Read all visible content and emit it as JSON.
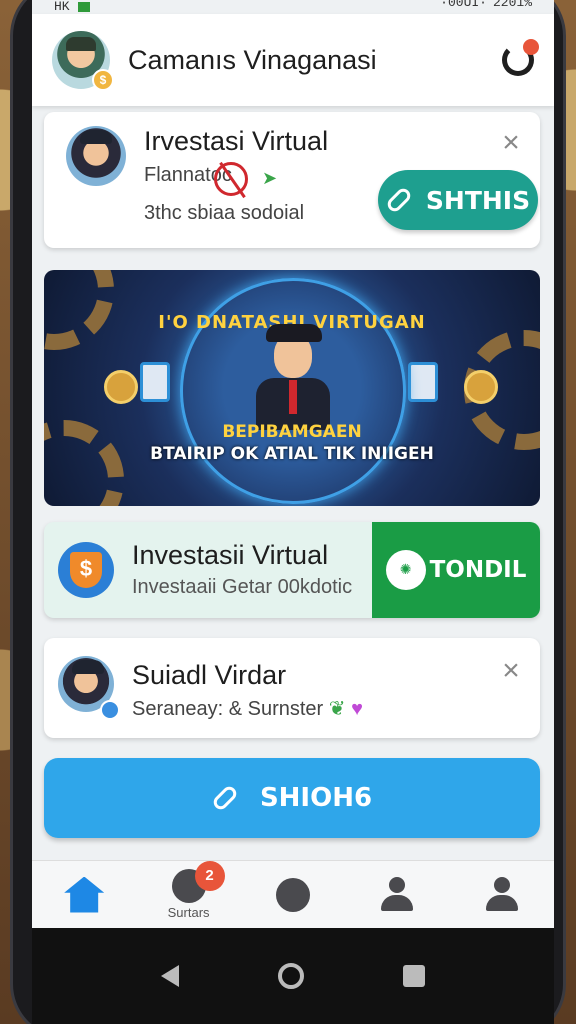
{
  "status_bar": {
    "left_text": "HK",
    "right_text": "·00UI·",
    "battery_text": "2201%"
  },
  "header": {
    "title": "Camanıs Vinaganasi",
    "avatar_icon": "pilot-avatar",
    "action_icon": "sync-icon"
  },
  "card1": {
    "title": "Irvestasi Virtual",
    "subtitle": "Flannatoc",
    "meta": "3thc sbiaa sodoial",
    "button_label": "SHTHIS"
  },
  "banner": {
    "headline": "I'O DNATASHI VIRTUGAN",
    "tagline": "BEPIBAMGAEN",
    "footer": "BTAIRIP OK ATIAL TIK INIIGEH"
  },
  "card3": {
    "title": "Investasii Virtual",
    "subtitle": "Investaaii Getar 00kdotic",
    "action_label": "TONDIL"
  },
  "card4": {
    "title": "Suiadl Virdar",
    "subtitle": "Seraneay: & Surnster"
  },
  "primary_button": {
    "label": "SHIOH6"
  },
  "bottom_nav": {
    "items": [
      {
        "icon": "home-icon",
        "label": ""
      },
      {
        "icon": "chat-icon",
        "label": "Surtars",
        "badge": "2"
      },
      {
        "icon": "globe-icon",
        "label": ""
      },
      {
        "icon": "profile-icon",
        "label": ""
      },
      {
        "icon": "account-icon",
        "label": ""
      }
    ]
  },
  "colors": {
    "teal": "#1e9f8f",
    "green": "#1a9c45",
    "blue": "#2fa6ea",
    "badge": "#e8553a"
  }
}
